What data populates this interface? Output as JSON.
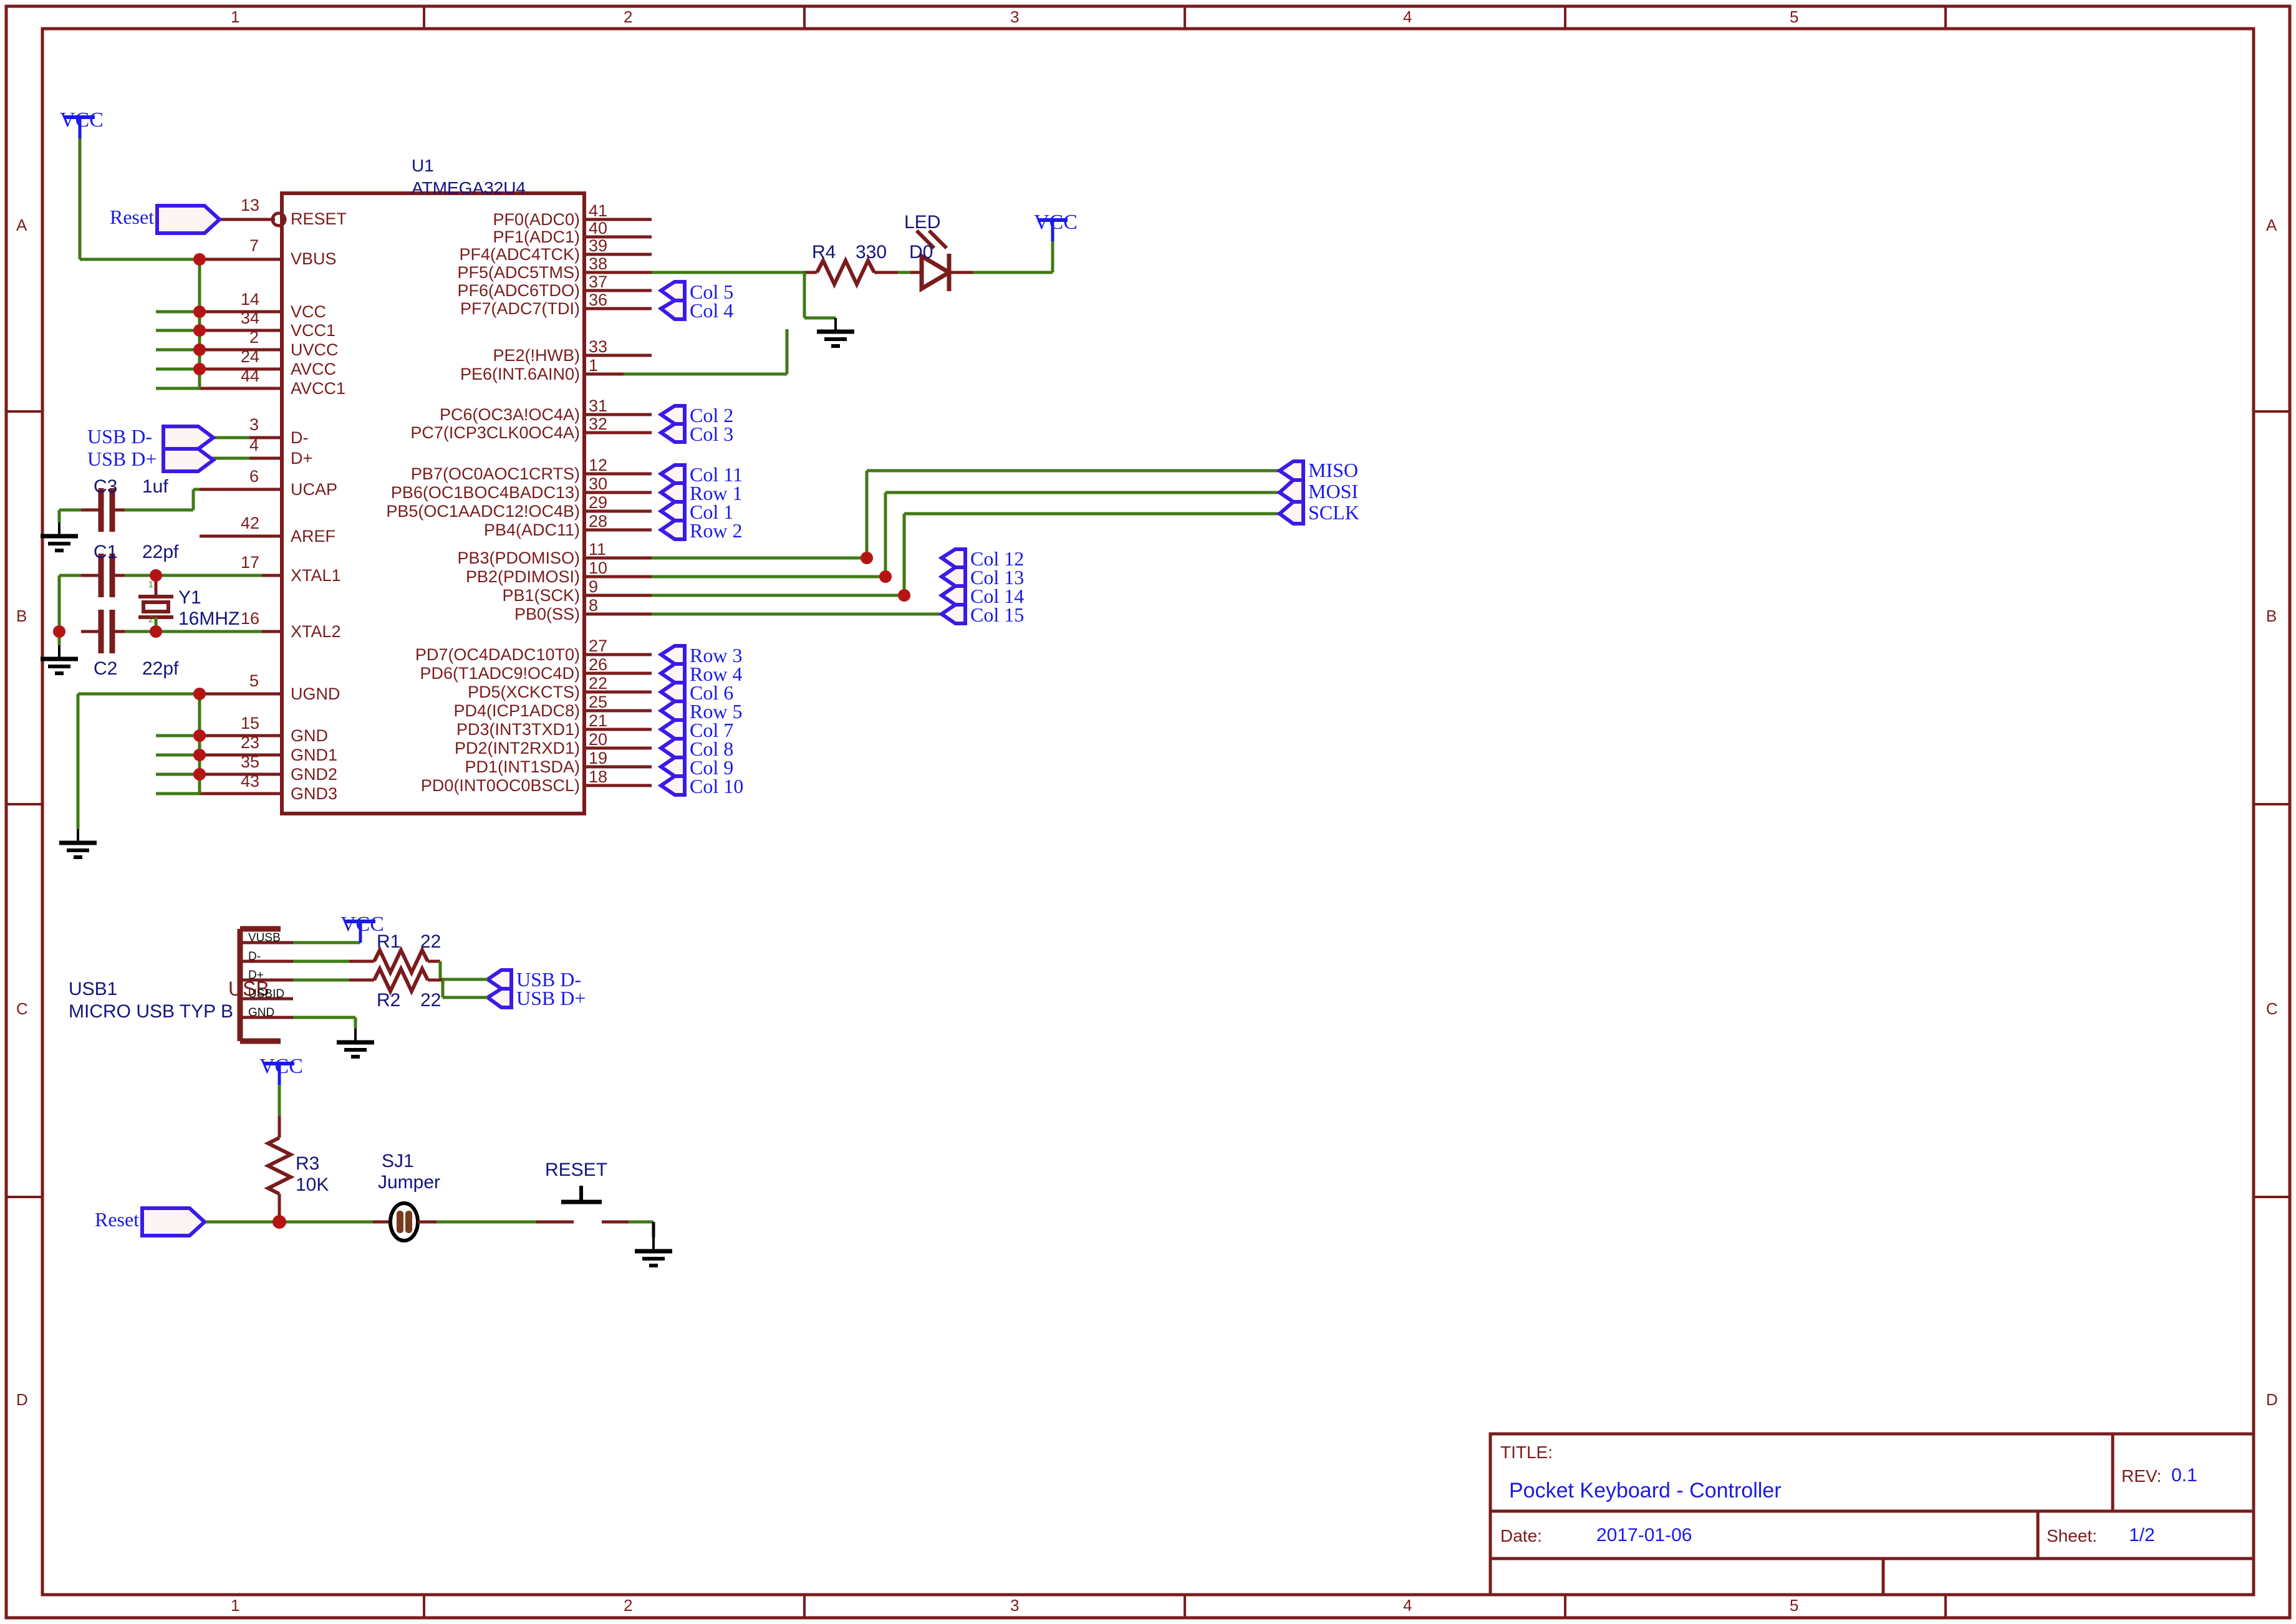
{
  "sheet": {
    "border_color": "#7a1c1c",
    "wire_color": "#3f7a14",
    "pin_color": "#7a1c1c",
    "label_color": "#1a1ae6",
    "value_color": "#14147a",
    "columns": [
      "1",
      "2",
      "3",
      "4",
      "5"
    ],
    "rows": [
      "A",
      "B",
      "C",
      "D"
    ]
  },
  "title_block": {
    "title_key": "TITLE:",
    "title_value": "Pocket Keyboard - Controller",
    "rev_key": "REV:",
    "rev_value": "0.1",
    "date_key": "Date:",
    "date_value": "2017-01-06",
    "sheet_key": "Sheet:",
    "sheet_value": "1/2"
  },
  "power_symbols": {
    "vcc": "VCC"
  },
  "u1": {
    "ref": "U1",
    "value": "ATMEGA32U4",
    "left_pins": [
      {
        "num": "13",
        "name": "RESET",
        "inverted": true
      },
      {
        "num": "7",
        "name": "VBUS"
      },
      {
        "num": "14",
        "name": "VCC"
      },
      {
        "num": "34",
        "name": "VCC1"
      },
      {
        "num": "2",
        "name": "UVCC"
      },
      {
        "num": "24",
        "name": "AVCC"
      },
      {
        "num": "44",
        "name": "AVCC1"
      },
      {
        "num": "3",
        "name": "D-"
      },
      {
        "num": "4",
        "name": "D+"
      },
      {
        "num": "6",
        "name": "UCAP"
      },
      {
        "num": "42",
        "name": "AREF"
      },
      {
        "num": "17",
        "name": "XTAL1"
      },
      {
        "num": "16",
        "name": "XTAL2"
      },
      {
        "num": "5",
        "name": "UGND"
      },
      {
        "num": "15",
        "name": "GND"
      },
      {
        "num": "23",
        "name": "GND1"
      },
      {
        "num": "35",
        "name": "GND2"
      },
      {
        "num": "43",
        "name": "GND3"
      }
    ],
    "right_pins": [
      {
        "num": "41",
        "name": "PF0(ADC0)",
        "net": ""
      },
      {
        "num": "40",
        "name": "PF1(ADC1)",
        "net": ""
      },
      {
        "num": "39",
        "name": "PF4(ADC4TCK)",
        "net": ""
      },
      {
        "num": "38",
        "name": "PF5(ADC5TMS)",
        "net": "LED"
      },
      {
        "num": "37",
        "name": "PF6(ADC6TDO)",
        "net": "Col 5"
      },
      {
        "num": "36",
        "name": "PF7(ADC7(TDI)",
        "net": "Col 4"
      },
      {
        "num": "33",
        "name": "PE2(!HWB)",
        "net": "GND"
      },
      {
        "num": "1",
        "name": "PE6(INT.6AIN0)",
        "net": ""
      },
      {
        "num": "31",
        "name": "PC6(OC3A!OC4A)",
        "net": "Col 2"
      },
      {
        "num": "32",
        "name": "PC7(ICP3CLK0OC4A)",
        "net": "Col 3"
      },
      {
        "num": "12",
        "name": "PB7(OC0AOC1CRTS)",
        "net": "Col 11"
      },
      {
        "num": "30",
        "name": "PB6(OC1BOC4BADC13)",
        "net": "Row 1"
      },
      {
        "num": "29",
        "name": "PB5(OC1AADC12!OC4B)",
        "net": "Col 1"
      },
      {
        "num": "28",
        "name": "PB4(ADC11)",
        "net": "Row 2"
      },
      {
        "num": "11",
        "name": "PB3(PDOMISO)",
        "net": "Col 12 / MISO"
      },
      {
        "num": "10",
        "name": "PB2(PDIMOSI)",
        "net": "Col 13 / MOSI"
      },
      {
        "num": "9",
        "name": "PB1(SCK)",
        "net": "Col 14 / SCLK"
      },
      {
        "num": "8",
        "name": "PB0(SS)",
        "net": "Col 15"
      },
      {
        "num": "27",
        "name": "PD7(OC4DADC10T0)",
        "net": "Row 3"
      },
      {
        "num": "26",
        "name": "PD6(T1ADC9!OC4D)",
        "net": "Row 4"
      },
      {
        "num": "22",
        "name": "PD5(XCKCTS)",
        "net": "Col 6"
      },
      {
        "num": "25",
        "name": "PD4(ICP1ADC8)",
        "net": "Row 5"
      },
      {
        "num": "21",
        "name": "PD3(INT3TXD1)",
        "net": "Col 7"
      },
      {
        "num": "20",
        "name": "PD2(INT2RXD1)",
        "net": "Col 8"
      },
      {
        "num": "19",
        "name": "PD1(INT1SDA)",
        "net": "Col 9"
      },
      {
        "num": "18",
        "name": "PD0(INT0OC0BSCL)",
        "net": "Col 10"
      }
    ]
  },
  "net_labels": {
    "reset_top": "Reset",
    "reset_bottom": "Reset",
    "usb_dm_left": "USB D-",
    "usb_dp_left": "USB D+",
    "usb_dm_right": "USB D-",
    "usb_dp_right": "USB D+",
    "col5": "Col 5",
    "col4": "Col 4",
    "col2": "Col 2",
    "col3": "Col 3",
    "col11": "Col 11",
    "row1": "Row 1",
    "col1": "Col 1",
    "row2": "Row 2",
    "col12": "Col 12",
    "col13": "Col 13",
    "col14": "Col 14",
    "col15": "Col 15",
    "miso": "MISO",
    "mosi": "MOSI",
    "sclk": "SCLK",
    "row3": "Row 3",
    "row4": "Row 4",
    "col6": "Col 6",
    "row5": "Row 5",
    "col7": "Col 7",
    "col8": "Col 8",
    "col9": "Col 9",
    "col10": "Col 10"
  },
  "components": {
    "c3": {
      "ref": "C3",
      "value": "1uf"
    },
    "c1": {
      "ref": "C1",
      "value": "22pf"
    },
    "c2": {
      "ref": "C2",
      "value": "22pf"
    },
    "y1": {
      "ref": "Y1",
      "value": "16MHZ",
      "pin1": "1",
      "pin2": "2"
    },
    "r4": {
      "ref": "R4",
      "value": "330"
    },
    "d0": {
      "ref": "D0",
      "label": "LED"
    },
    "usb1": {
      "ref": "USB1",
      "value": "MICRO USB TYP B",
      "body_label": "USB",
      "pins": [
        "VUSB",
        "D-",
        "D+",
        "USBID",
        "GND"
      ]
    },
    "r1": {
      "ref": "R1",
      "value": "22"
    },
    "r2": {
      "ref": "R2",
      "value": "22"
    },
    "r3": {
      "ref": "R3",
      "value": "10K"
    },
    "sj1": {
      "ref": "SJ1",
      "value": "Jumper"
    },
    "reset_sw": {
      "label": "RESET"
    }
  }
}
